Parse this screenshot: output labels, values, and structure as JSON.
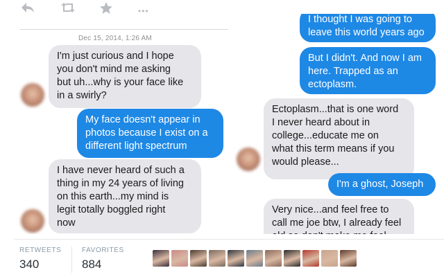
{
  "actions": {
    "reply_icon": "reply-icon",
    "retweet_icon": "retweet-icon",
    "favorite_icon": "star-icon",
    "more_icon": "more-icon",
    "more_glyph": "•••"
  },
  "left_screenshot": {
    "timestamp": "Dec 15, 2014, 1:26 AM",
    "messages": [
      {
        "side": "in",
        "text": "I'm just curious and I hope\nyou don't mind me asking\nbut uh...why is your face like\nin a swirly?"
      },
      {
        "side": "out",
        "text": "My face doesn't appear in\nphotos because I exist on a\ndifferent light spectrum"
      },
      {
        "side": "in",
        "text": "I have never heard of such a\nthing in my 24 years of living\non this earth...my mind is\nlegit totally boggled right\nnow"
      }
    ]
  },
  "right_screenshot": {
    "messages": [
      {
        "side": "out",
        "text": "I thought I was going to\nleave this world years ago"
      },
      {
        "side": "out",
        "text": "But I didn't. And now I am\nhere. Trapped as an\nectoplasm."
      },
      {
        "side": "in",
        "text": "Ectoplasm...that is one word\nI never heard about in\ncollege...educate me on\nwhat this term means if you\nwould please..."
      },
      {
        "side": "out",
        "text": "I'm a ghost, Joseph"
      },
      {
        "side": "in",
        "text": "Very nice...and feel free to\ncall me joe btw, I already feel\nold so don't make me feel"
      }
    ]
  },
  "stats": {
    "retweets_label": "RETWEETS",
    "retweets_value": "340",
    "favorites_label": "FAVORITES",
    "favorites_value": "884"
  },
  "faces": {
    "count": 11,
    "colors": [
      "#3a2f3b",
      "#c98a8a",
      "#4b3a30",
      "#7a6a5e",
      "#2f3640",
      "#6b7c8a",
      "#8a6a5a",
      "#2a2a2a",
      "#b33a2e",
      "#c7a48c",
      "#5a3a2a"
    ]
  },
  "colors": {
    "incoming_bubble": "#e5e5ea",
    "outgoing_bubble": "#1e88e5",
    "icon_gray": "#b9bcc0"
  }
}
